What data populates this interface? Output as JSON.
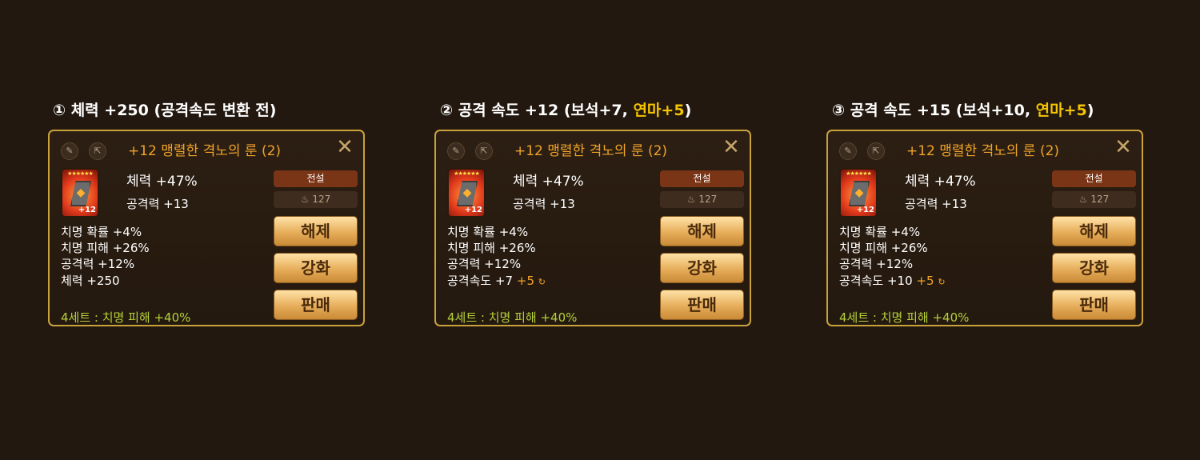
{
  "captions": [
    {
      "prefix": "① 체력 +250 (공격속도 변환 전)",
      "highlight": "",
      "suffix": ""
    },
    {
      "prefix": "② 공격 속도 +12 (보석+7, ",
      "highlight": "연마+5",
      "suffix": ")"
    },
    {
      "prefix": "③ 공격 속도 +15 (보석+10, ",
      "highlight": "연마+5",
      "suffix": ")"
    }
  ],
  "panels": [
    {
      "title": "+12 맹렬한 격노의 룬 (2)",
      "rune_level": "+12",
      "main_stat": "체력 +47%",
      "innate_stat": "공격력 +13",
      "grade": "전설",
      "power": "127",
      "sub_stats": [
        "치명 확률 +4%",
        "치명 피해 +26%",
        "공격력 +12%",
        "체력 +250"
      ],
      "sub_plus": "",
      "buttons": {
        "unequip": "해제",
        "upgrade": "강화",
        "sell": "판매"
      },
      "set_bonus": "4세트 : 치명 피해 +40%"
    },
    {
      "title": "+12 맹렬한 격노의 룬 (2)",
      "rune_level": "+12",
      "main_stat": "체력 +47%",
      "innate_stat": "공격력 +13",
      "grade": "전설",
      "power": "127",
      "sub_stats": [
        "치명 확률 +4%",
        "치명 피해 +26%",
        "공격력 +12%",
        "공격속도 +7"
      ],
      "sub_plus": "+5",
      "buttons": {
        "unequip": "해제",
        "upgrade": "강화",
        "sell": "판매"
      },
      "set_bonus": "4세트 : 치명 피해 +40%"
    },
    {
      "title": "+12 맹렬한 격노의 룬 (2)",
      "rune_level": "+12",
      "main_stat": "체력 +47%",
      "innate_stat": "공격력 +13",
      "grade": "전설",
      "power": "127",
      "sub_stats": [
        "치명 확률 +4%",
        "치명 피해 +26%",
        "공격력 +12%",
        "공격속도 +10"
      ],
      "sub_plus": "+5",
      "buttons": {
        "unequip": "해제",
        "upgrade": "강화",
        "sell": "판매"
      },
      "set_bonus": "4세트 : 치명 피해 +40%"
    }
  ],
  "icons": {
    "edit": "pencil-icon",
    "share": "share-icon",
    "close": "close-icon",
    "power": "flame-icon",
    "reroll": "reroll-icon"
  },
  "colors": {
    "background": "#22180f",
    "panel_border": "#c9a23c",
    "title": "#f0a42a",
    "highlight": "#f5c400",
    "set_bonus": "#b5cf3a",
    "grade_badge": "#7a3416"
  }
}
